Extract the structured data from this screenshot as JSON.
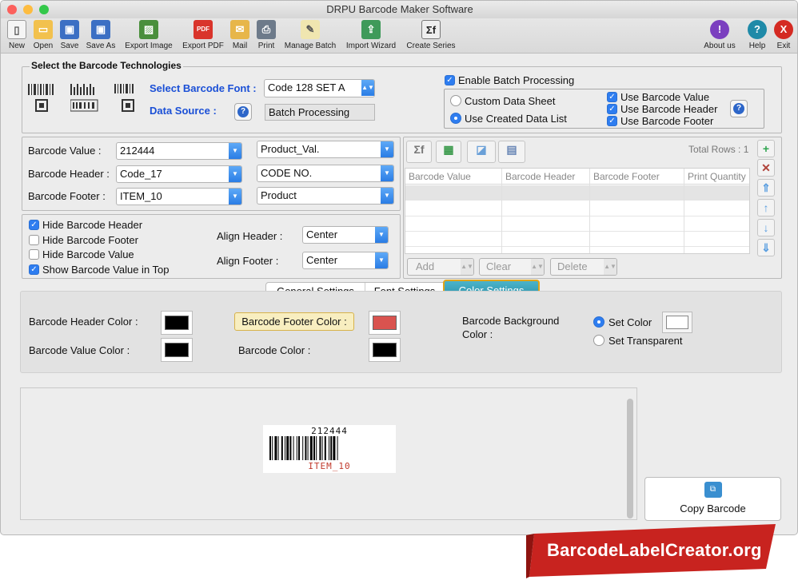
{
  "window": {
    "title": "DRPU Barcode Maker Software"
  },
  "toolbar": {
    "new": "New",
    "open": "Open",
    "save": "Save",
    "save_as": "Save As",
    "export_image": "Export Image",
    "export_pdf": "Export PDF",
    "mail": "Mail",
    "print": "Print",
    "manage_batch": "Manage Batch",
    "import_wizard": "Import Wizard",
    "create_series": "Create Series",
    "about": "About us",
    "help": "Help",
    "exit": "Exit"
  },
  "tech": {
    "group_title": "Select the Barcode Technologies",
    "font_label": "Select Barcode Font :",
    "font_value": "Code 128 SET A",
    "source_label": "Data Source :",
    "source_value": "Batch Processing"
  },
  "batch": {
    "enable_label": "Enable Batch Processing",
    "enable_checked": true,
    "custom_sheet": "Custom Data Sheet",
    "use_created": "Use Created Data List",
    "selected_mode": "Use Created Data List",
    "use_value": "Use Barcode Value",
    "use_header": "Use Barcode Header",
    "use_footer": "Use Barcode Footer"
  },
  "fields": {
    "value_label": "Barcode Value :",
    "value": "212444",
    "value_col": "Product_Val.",
    "header_label": "Barcode Header :",
    "header": "Code_17",
    "header_col": "CODE NO.",
    "footer_label": "Barcode Footer :",
    "footer": "ITEM_10",
    "footer_col": "Product"
  },
  "options": {
    "hide_header": "Hide Barcode Header",
    "hide_header_checked": true,
    "hide_footer": "Hide Barcode Footer",
    "hide_footer_checked": false,
    "hide_value": "Hide Barcode Value",
    "hide_value_checked": false,
    "show_top": "Show Barcode Value in Top",
    "show_top_checked": true,
    "align_header_label": "Align Header :",
    "align_header": "Center",
    "align_footer_label": "Align Footer :",
    "align_footer": "Center"
  },
  "grid": {
    "total_rows": "Total Rows : 1",
    "columns": [
      "Barcode Value",
      "Barcode Header",
      "Barcode Footer",
      "Print Quantity"
    ],
    "add": "Add",
    "clear": "Clear",
    "delete": "Delete"
  },
  "tabs": {
    "general": "General Settings",
    "font": "Font Settings",
    "color": "Color Settings",
    "active": "Color Settings"
  },
  "colors": {
    "header_color_label": "Barcode Header Color :",
    "header_color": "#000000",
    "footer_color_label": "Barcode Footer Color :",
    "footer_color": "#d9534f",
    "value_color_label": "Barcode Value Color :",
    "value_color": "#000000",
    "barcode_color_label": "Barcode Color :",
    "barcode_color": "#000000",
    "bg_label_1": "Barcode Background",
    "bg_label_2": "Color :",
    "set_color": "Set Color",
    "set_transparent": "Set Transparent",
    "bg_mode": "Set Color",
    "bg_color": "#ffffff"
  },
  "preview": {
    "value": "212444",
    "footer": "ITEM_10",
    "footer_color": "#c0392b"
  },
  "copy_button": "Copy Barcode",
  "watermark": "BarcodeLabelCreator.org"
}
